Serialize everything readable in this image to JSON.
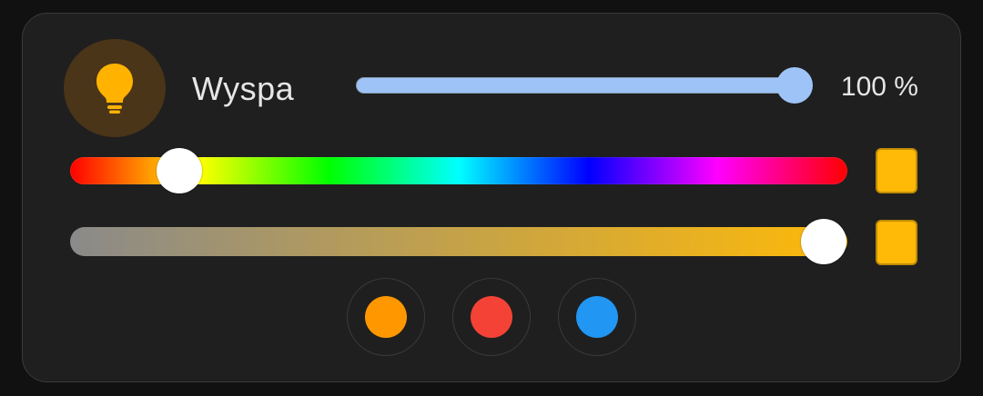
{
  "light": {
    "name": "Wyspa",
    "icon": "lightbulb-icon",
    "icon_color": "#ffb300",
    "icon_bg": "#4a3518"
  },
  "brightness": {
    "value": 100,
    "label": "100 %"
  },
  "hue": {
    "position": 0.14,
    "swatch_color": "#ffba08"
  },
  "color_temp": {
    "position": 0.97,
    "swatch_color": "#ffba08"
  },
  "presets": [
    {
      "name": "orange",
      "color": "#ff9800"
    },
    {
      "name": "red",
      "color": "#f44336"
    },
    {
      "name": "blue",
      "color": "#2196f3"
    }
  ]
}
